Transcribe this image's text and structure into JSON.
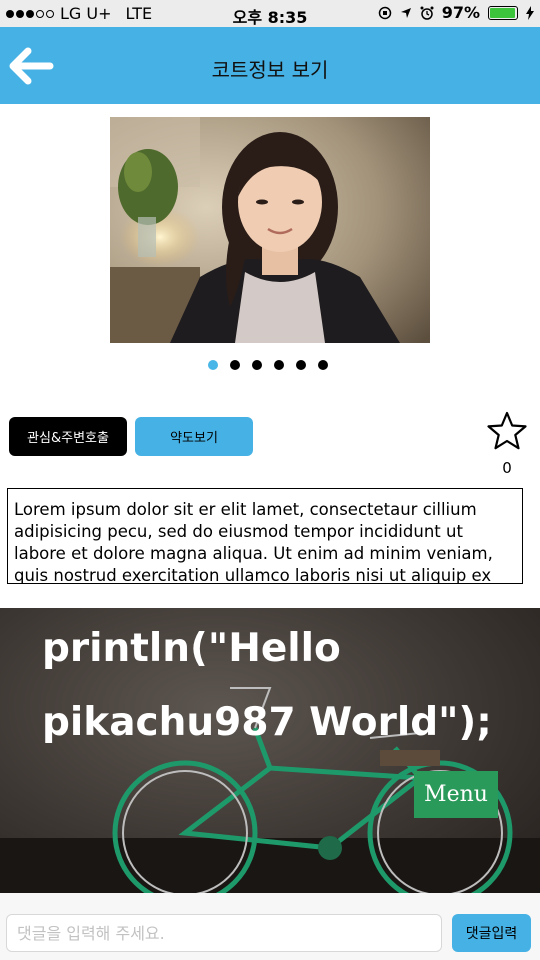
{
  "status_bar": {
    "carrier": "LG U+",
    "network": "LTE",
    "time": "오후 8:35",
    "battery_percent": "97%",
    "signal_bars": 3
  },
  "header": {
    "title": "코트정보 보기",
    "back_icon": "arrow-left-icon",
    "color": "#45b1e4"
  },
  "gallery": {
    "image": "portrait-photo",
    "page_count": 6,
    "active_index": 0
  },
  "actions": {
    "interest_label": "관심&주변호출",
    "map_label": "약도보기",
    "favorite_count": "0"
  },
  "description": "Lorem ipsum dolor sit er elit lamet, consectetaur cillium adipisicing pecu, sed do eiusmod tempor incididunt ut labore et dolore magna aliqua. Ut enim ad minim veniam, quis nostrud exercitation ullamco laboris nisi ut aliquip ex ea",
  "banner": {
    "line1": "println(\"Hello",
    "line2": "pikachu987 World\");",
    "menu_label": "Menu"
  },
  "comment": {
    "placeholder": "댓글을 입력해 주세요.",
    "value": "",
    "submit_label": "댓글입력"
  }
}
